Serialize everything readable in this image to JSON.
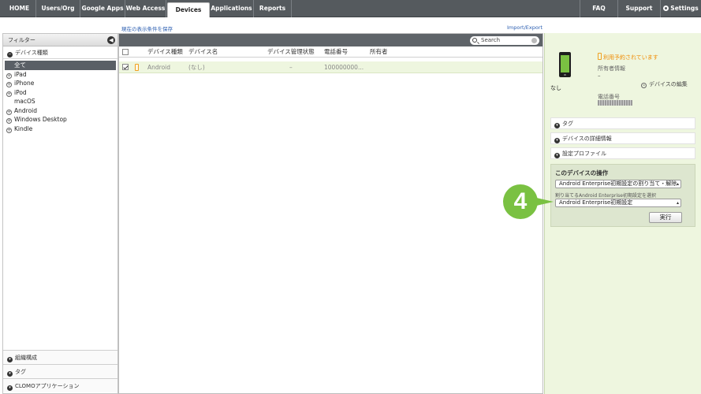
{
  "nav": {
    "home": "HOME",
    "users_org": "Users/Org",
    "google_apps": "Google Apps",
    "web_access": "Web Access",
    "devices": "Devices",
    "applications": "Applications",
    "reports": "Reports",
    "faq": "FAQ",
    "support": "Support",
    "settings": "Settings"
  },
  "links": {
    "save_filter": "現在の表示条件を保存",
    "import_export": "Import/Export"
  },
  "sidebar": {
    "filter_label": "フィルター",
    "collapse_glyph": "◀",
    "device_type_label": "デバイス種類",
    "tree": [
      {
        "label": "全て",
        "expander": ""
      },
      {
        "label": "iPad",
        "expander": "+"
      },
      {
        "label": "iPhone",
        "expander": "+"
      },
      {
        "label": "iPod",
        "expander": "+"
      },
      {
        "label": "macOS",
        "expander": ""
      },
      {
        "label": "Android",
        "expander": "+"
      },
      {
        "label": "Windows Desktop",
        "expander": "+"
      },
      {
        "label": "Kindle",
        "expander": "+"
      }
    ],
    "bottom": {
      "org": "組織構成",
      "tag": "タグ",
      "clomo_apps": "CLOMOアプリケーション"
    }
  },
  "table": {
    "search_placeholder": "Search",
    "headers": {
      "device_type": "デバイス種類",
      "device_name": "デバイス名",
      "management_status": "デバイス管理状態",
      "phone_number": "電話番号",
      "owner": "所有者"
    },
    "rows": [
      {
        "device_type": "Android",
        "device_name": "(なし)",
        "management_status": "–",
        "phone_number": "100000000...",
        "owner": ""
      }
    ]
  },
  "detail": {
    "reservation_status": "利用予約されています",
    "owner_info_label": "所有者情報",
    "owner_info_value": "–",
    "device_name": "なし",
    "edit_device": "デバイスの編集",
    "phone_label": "電話番号",
    "sections": {
      "tag": "タグ",
      "device_details": "デバイスの詳細情報",
      "config_profile": "設定プロファイル"
    },
    "operations": {
      "title": "このデバイスの操作",
      "action_selected": "Android Enterprise初期設定の割り当て・解除",
      "assign_label": "割り当てるAndroid Enterprise初期設定を選択",
      "setting_selected": "Android Enterprise初期設定",
      "run_button": "実行"
    }
  },
  "annotation": {
    "step_number": "4",
    "color": "#7ac142"
  }
}
